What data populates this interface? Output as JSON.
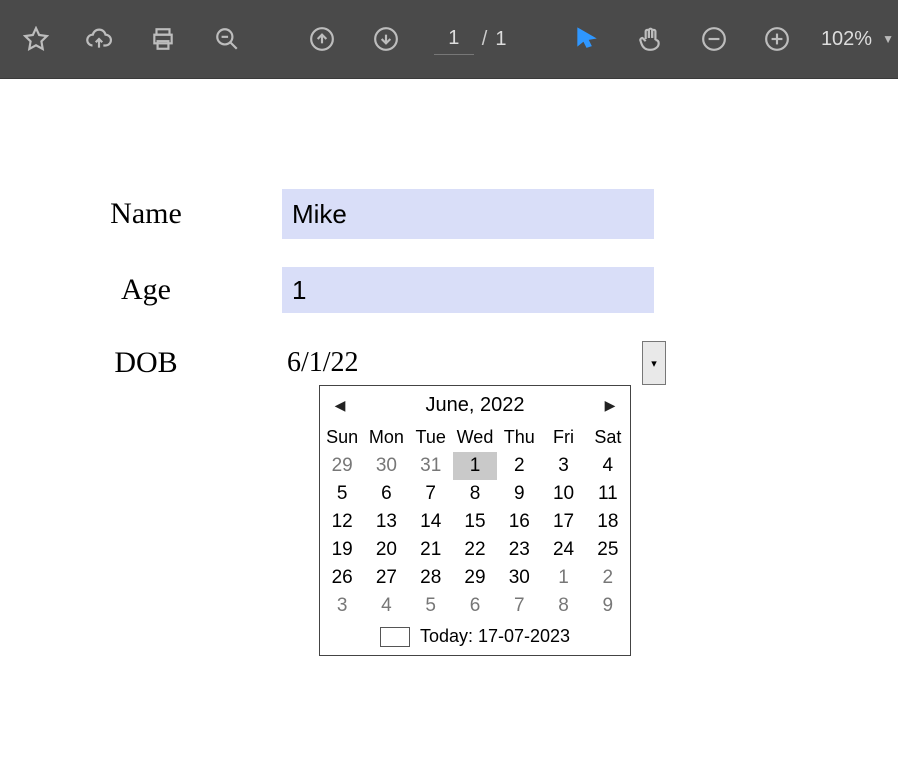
{
  "toolbar": {
    "page_current": "1",
    "page_sep": "/",
    "page_total": "1",
    "zoom": "102%"
  },
  "form": {
    "name_label": "Name",
    "name_value": "Mike",
    "age_label": "Age",
    "age_value": "1",
    "dob_label": "DOB",
    "dob_value": "6/1/22"
  },
  "calendar": {
    "title": "June, 2022",
    "days": [
      "Sun",
      "Mon",
      "Tue",
      "Wed",
      "Thu",
      "Fri",
      "Sat"
    ],
    "weeks": [
      [
        {
          "d": "29",
          "o": true
        },
        {
          "d": "30",
          "o": true
        },
        {
          "d": "31",
          "o": true
        },
        {
          "d": "1",
          "sel": true
        },
        {
          "d": "2"
        },
        {
          "d": "3"
        },
        {
          "d": "4"
        }
      ],
      [
        {
          "d": "5"
        },
        {
          "d": "6"
        },
        {
          "d": "7"
        },
        {
          "d": "8"
        },
        {
          "d": "9"
        },
        {
          "d": "10"
        },
        {
          "d": "11"
        }
      ],
      [
        {
          "d": "12"
        },
        {
          "d": "13"
        },
        {
          "d": "14"
        },
        {
          "d": "15"
        },
        {
          "d": "16"
        },
        {
          "d": "17"
        },
        {
          "d": "18"
        }
      ],
      [
        {
          "d": "19"
        },
        {
          "d": "20"
        },
        {
          "d": "21"
        },
        {
          "d": "22"
        },
        {
          "d": "23"
        },
        {
          "d": "24"
        },
        {
          "d": "25"
        }
      ],
      [
        {
          "d": "26"
        },
        {
          "d": "27"
        },
        {
          "d": "28"
        },
        {
          "d": "29"
        },
        {
          "d": "30"
        },
        {
          "d": "1",
          "o": true
        },
        {
          "d": "2",
          "o": true
        }
      ],
      [
        {
          "d": "3",
          "o": true
        },
        {
          "d": "4",
          "o": true
        },
        {
          "d": "5",
          "o": true
        },
        {
          "d": "6",
          "o": true
        },
        {
          "d": "7",
          "o": true
        },
        {
          "d": "8",
          "o": true
        },
        {
          "d": "9",
          "o": true
        }
      ]
    ],
    "today_label": "Today: 17-07-2023"
  }
}
